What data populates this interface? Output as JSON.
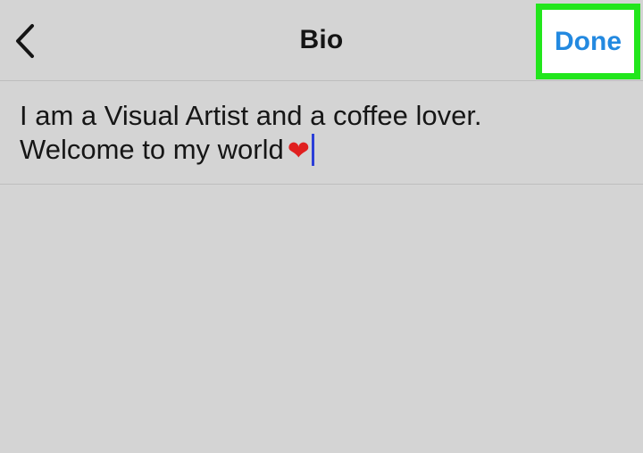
{
  "nav": {
    "back_icon": "chevron-left-icon",
    "title": "Bio",
    "done_label": "Done",
    "highlight_color": "#22e61c",
    "accent_color": "#2389e0"
  },
  "bio": {
    "line1": "I am a Visual Artist and a coffee lover.",
    "line2": "Welcome to my world",
    "emoji": "❤",
    "emoji_icon": "heart-icon"
  }
}
